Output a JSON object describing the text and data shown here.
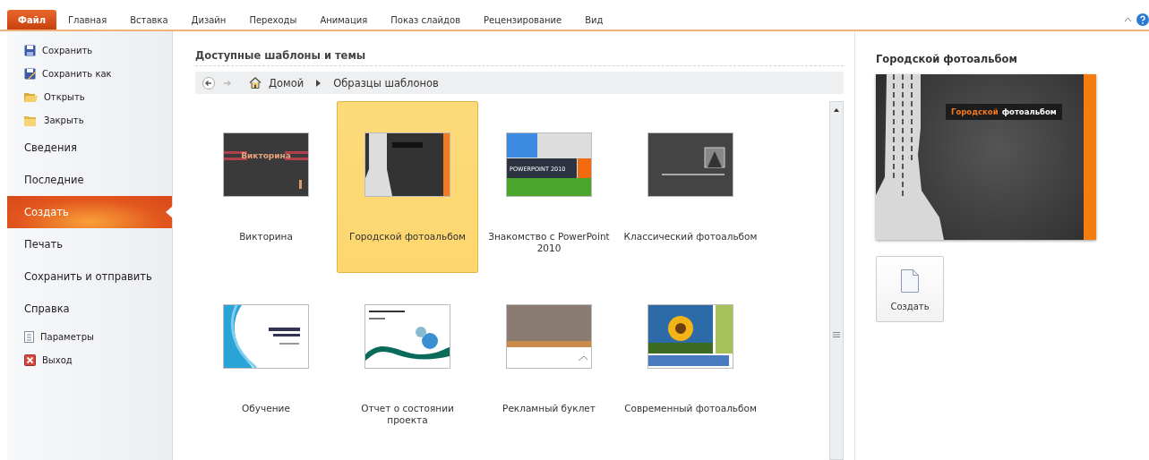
{
  "ribbon_tabs": [
    {
      "label": "Файл",
      "selected": true
    },
    {
      "label": "Главная",
      "selected": false
    },
    {
      "label": "Вставка",
      "selected": false
    },
    {
      "label": "Дизайн",
      "selected": false
    },
    {
      "label": "Переходы",
      "selected": false
    },
    {
      "label": "Анимация",
      "selected": false
    },
    {
      "label": "Показ слайдов",
      "selected": false
    },
    {
      "label": "Рецензирование",
      "selected": false
    },
    {
      "label": "Вид",
      "selected": false
    }
  ],
  "sidebar": {
    "items": [
      {
        "kind": "command",
        "label": "Сохранить",
        "selected": false
      },
      {
        "kind": "command",
        "label": "Сохранить как",
        "selected": false
      },
      {
        "kind": "command",
        "label": "Открыть",
        "selected": false
      },
      {
        "kind": "command",
        "label": "Закрыть",
        "selected": false
      },
      {
        "kind": "section",
        "label": "Сведения",
        "selected": false
      },
      {
        "kind": "section",
        "label": "Последние",
        "selected": false
      },
      {
        "kind": "section",
        "label": "Создать",
        "selected": true
      },
      {
        "kind": "section",
        "label": "Печать",
        "selected": false
      },
      {
        "kind": "section",
        "label": "Сохранить и отправить",
        "selected": false
      },
      {
        "kind": "section",
        "label": "Справка",
        "selected": false
      },
      {
        "kind": "command",
        "label": "Параметры",
        "selected": false
      },
      {
        "kind": "command",
        "label": "Выход",
        "selected": false
      }
    ]
  },
  "gallery": {
    "heading": "Доступные шаблоны и темы",
    "breadcrumb": [
      "Домой",
      "Образцы шаблонов"
    ],
    "templates": [
      {
        "kind": "quiz",
        "name": "Викторина",
        "thumb_title": "Викторина",
        "selected": false
      },
      {
        "kind": "city",
        "name": "Городской фотоальбом",
        "selected": true
      },
      {
        "kind": "intro",
        "name": "Знакомство с PowerPoint 2010",
        "thumb_title": "POWERPOINT 2010",
        "selected": false
      },
      {
        "kind": "classic",
        "name": "Классический фотоальбом",
        "selected": false
      },
      {
        "kind": "training",
        "name": "Обучение",
        "selected": false
      },
      {
        "kind": "report",
        "name": "Отчет о состоянии проекта",
        "selected": false
      },
      {
        "kind": "booklet",
        "name": "Рекламный буклет",
        "selected": false
      },
      {
        "kind": "modern",
        "name": "Современный фотоальбом",
        "selected": false
      }
    ]
  },
  "preview": {
    "title": "Городской фотоальбом",
    "slide_title": [
      "Городской",
      "фотоальбом"
    ],
    "create_button": "Создать"
  }
}
